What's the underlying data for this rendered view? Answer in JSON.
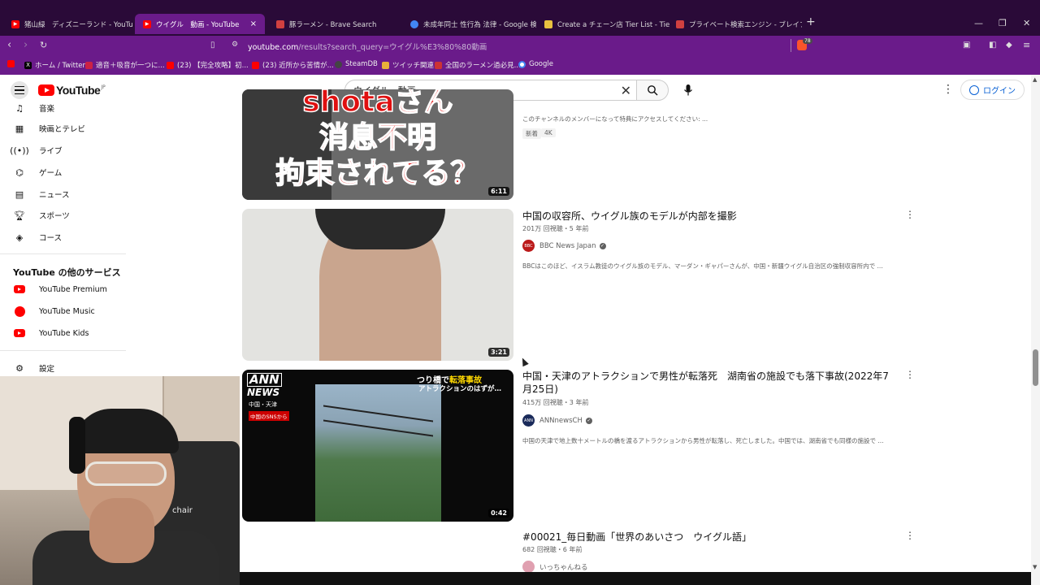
{
  "browser": {
    "tabs": [
      {
        "label": "猪山緑　ディズニーランド - YouTube",
        "favicon_color": "#ff0000"
      },
      {
        "label": "ウイグル　動画 - YouTube",
        "favicon_color": "#ff0000"
      },
      {
        "label": "豚ラーメン - Brave Search",
        "favicon_color": "#d04040"
      },
      {
        "label": "未成年同士 性行為 法律 - Google 検",
        "favicon_color": "#4285f4"
      },
      {
        "label": "Create a チェーン店 Tier List - TierMake",
        "favicon_color": "#e8c040"
      },
      {
        "label": "プライベート検索エンジン - ブレイブ検索",
        "favicon_color": "#d04040"
      }
    ],
    "new_tab": "+",
    "tab_close": "×",
    "window_controls": [
      "—",
      "❐",
      "✕"
    ],
    "url_host": "youtube.com",
    "url_rest": "/results?search_query=ウイグル%E3%80%80動画",
    "shield_count": "78",
    "bookmarks": [
      {
        "label": "ホーム / Twitter",
        "color": "#000000"
      },
      {
        "label": "適音＋吸音が一つに...",
        "color": "#cc2244"
      },
      {
        "label": "(23) 【完全攻略】初...",
        "color": "#ff0000"
      },
      {
        "label": "(23) 近所から苦情が...",
        "color": "#ff0000"
      },
      {
        "label": "SteamDB",
        "color": "#444444"
      },
      {
        "label": "ツイッチ関連",
        "color": "#e8b03a"
      },
      {
        "label": "全国のラーメン過必見...",
        "color": "#cc3333"
      },
      {
        "label": "Google",
        "color": "#4285f4"
      }
    ]
  },
  "youtube": {
    "logo_text": "YouTube",
    "logo_region": "JP",
    "search_query": "ウイグル　動画",
    "login_label": "ログイン"
  },
  "sidebar": {
    "items": [
      {
        "label": "音楽",
        "icon": "music-note-icon"
      },
      {
        "label": "映画とテレビ",
        "icon": "film-icon"
      },
      {
        "label": "ライブ",
        "icon": "live-icon"
      },
      {
        "label": "ゲーム",
        "icon": "gamepad-icon"
      },
      {
        "label": "ニュース",
        "icon": "news-icon"
      },
      {
        "label": "スポーツ",
        "icon": "trophy-icon"
      },
      {
        "label": "コース",
        "icon": "course-icon"
      }
    ],
    "section_title": "YouTube の他のサービス",
    "services": [
      {
        "label": "YouTube Premium"
      },
      {
        "label": "YouTube Music"
      },
      {
        "label": "YouTube Kids"
      }
    ],
    "settings_label": "設定"
  },
  "webcam": {
    "chair_text": "chair"
  },
  "results": [
    {
      "thumb_text": [
        "shotaさん",
        "消息不明",
        "拘束されてる？"
      ],
      "duration": "6:11",
      "desc": "このチャンネルのメンバーになって特典にアクセスしてください: ...",
      "badges": [
        "新着",
        "4K"
      ]
    },
    {
      "title": "中国の収容所、ウイグル族のモデルが内部を撮影",
      "meta": "201万 回視聴・5 年前",
      "channel": "BBC News Japan",
      "channel_color": "#bb1919",
      "channel_av": "BBC",
      "desc": "BBCはこのほど、イスラム教徒のウイグル族のモデル、マーダン・ギャパーさんが、中国・新疆ウイグル自治区の強制収容所内で ...",
      "duration": "3:21"
    },
    {
      "title": "中国・天津のアトラクションで男性が転落死　湖南省の施設でも落下事故(2022年7月25日)",
      "meta": "415万 回視聴・3 年前",
      "channel": "ANNnewsCH",
      "channel_color": "#1a2a5a",
      "channel_av": "ANN",
      "desc": "中国の天津で地上数十メートルの橋を渡るアトラクションから男性が転落し、死亡しました。中国では、湖南省でも同様の施設で ...",
      "duration": "0:42",
      "thumb_logo": "ANN",
      "thumb_logo2": "NEWS",
      "thumb_region": "中国・天津",
      "thumb_source": "中国のSNSから",
      "thumb_caption1_a": "つり橋で",
      "thumb_caption1_b": "転落事故",
      "thumb_caption2": "アトラクションのはずが…"
    },
    {
      "title": "#00021_毎日動画「世界のあいさつ　ウイグル語」",
      "meta": "682 回視聴・6 年前",
      "channel": "いっちゃんねる",
      "channel_color": "#e0a0b0"
    }
  ]
}
